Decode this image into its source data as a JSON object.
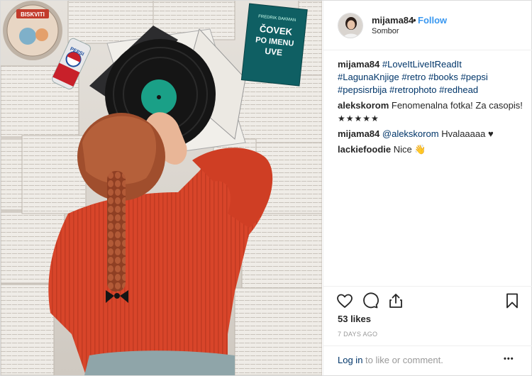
{
  "post": {
    "author": "mijama84",
    "separator": "•",
    "follow_label": "Follow",
    "location": "Sombor",
    "caption": {
      "user": "mijama84",
      "tags": [
        "#LoveItLiveItReadIt",
        "#LagunaKnjige",
        "#retro",
        "#books",
        "#pepsi",
        "#pepsisrbija",
        "#retrophoto",
        "#redhead"
      ]
    },
    "comments": [
      {
        "user": "alekskorom",
        "text": "Fenomenalna fotka! Za casopis!",
        "extra": "★★★★★"
      },
      {
        "user": "mijama84",
        "mention": "@alekskorom",
        "text": "Hvalaaaaa ♥"
      },
      {
        "user": "lackiefoodie",
        "text": "Nice 👋"
      }
    ],
    "likes": "53 likes",
    "time_ago": "7 DAYS AGO",
    "login_link": "Log in",
    "login_rest": " to like or comment.",
    "more_label": "•••"
  },
  "photo_text": {
    "book_title_line1": "ČOVEK",
    "book_title_line2": "PO IMENU",
    "book_title_line3": "UVE",
    "book_author": "FREDRIK BAKMAN",
    "tin_label": "BISKVITI",
    "can_brand": "PEPSI"
  },
  "icons": {
    "like": "heart-icon",
    "comment": "comment-icon",
    "share": "share-icon",
    "save": "bookmark-icon",
    "more": "more-options-icon"
  },
  "colors": {
    "link_blue": "#3897f0",
    "hashtag_blue": "#003569",
    "sweater_red": "#d9462b",
    "hair_auburn": "#9c4a2c"
  }
}
